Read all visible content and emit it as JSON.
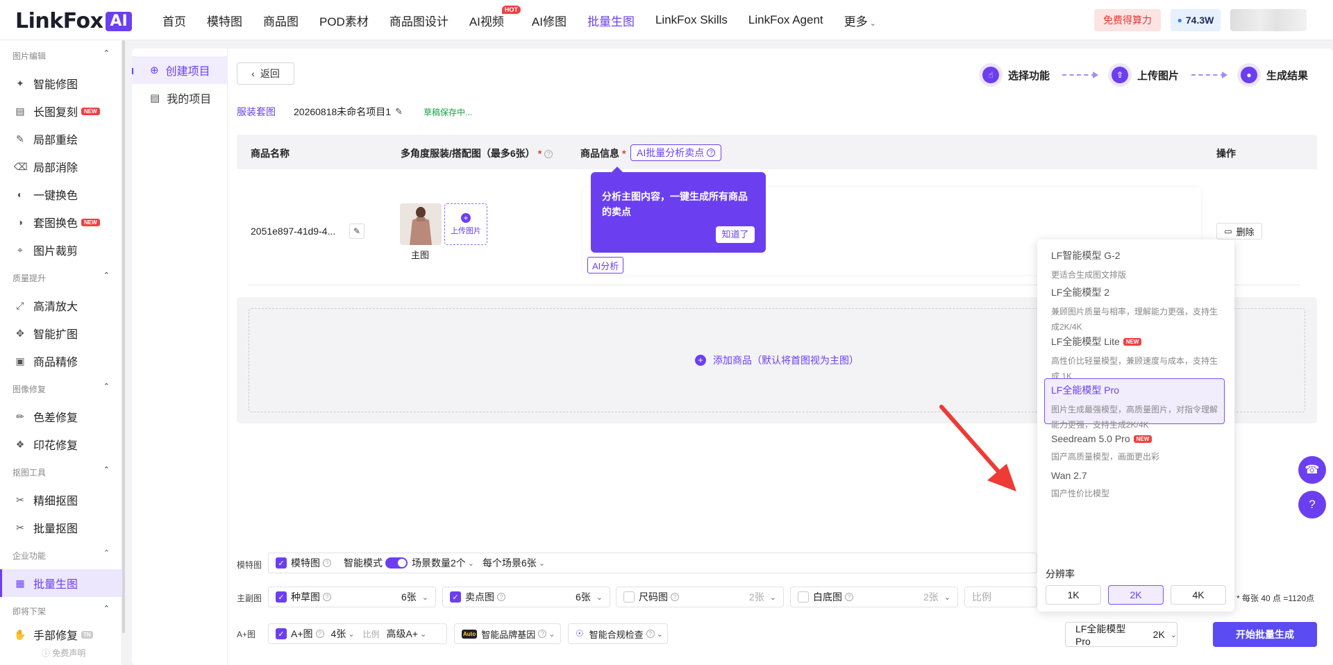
{
  "header": {
    "logo_text": "LinkFox",
    "logo_badge": "AI",
    "nav": [
      {
        "label": "首页"
      },
      {
        "label": "模特图"
      },
      {
        "label": "商品图"
      },
      {
        "label": "POD素材"
      },
      {
        "label": "商品图设计"
      },
      {
        "label": "AI视频",
        "badge": "HOT"
      },
      {
        "label": "AI修图"
      },
      {
        "label": "批量生图",
        "active": true
      },
      {
        "label": "LinkFox Skills"
      },
      {
        "label": "LinkFox Agent"
      },
      {
        "label": "更多"
      }
    ],
    "free_button": "免费得算力",
    "balance": "74.3W",
    "accent_color": "#6b3ff0"
  },
  "sidebar": {
    "groups": [
      {
        "title": "图片编辑",
        "items": [
          {
            "label": "智能修图",
            "icon": "magic-wand-icon"
          },
          {
            "label": "长图复刻",
            "icon": "copy-icon",
            "badge": "NEW"
          },
          {
            "label": "局部重绘",
            "icon": "brush-icon"
          },
          {
            "label": "局部消除",
            "icon": "eraser-icon"
          },
          {
            "label": "一键换色",
            "icon": "palette-icon"
          },
          {
            "label": "套图换色",
            "icon": "palette-icon",
            "badge": "NEW"
          },
          {
            "label": "图片裁剪",
            "icon": "crop-icon"
          }
        ]
      },
      {
        "title": "质量提升",
        "items": [
          {
            "label": "高清放大",
            "icon": "enlarge-icon"
          },
          {
            "label": "智能扩图",
            "icon": "expand-icon"
          },
          {
            "label": "商品精修",
            "icon": "retouch-icon"
          }
        ]
      },
      {
        "title": "图像修复",
        "items": [
          {
            "label": "色差修复",
            "icon": "dropper-icon"
          },
          {
            "label": "印花修复",
            "icon": "pattern-icon"
          }
        ]
      },
      {
        "title": "抠图工具",
        "items": [
          {
            "label": "精细抠图",
            "icon": "cutout-icon"
          },
          {
            "label": "批量抠图",
            "icon": "cutout-icon"
          }
        ]
      },
      {
        "title": "企业功能",
        "items": [
          {
            "label": "批量生图",
            "icon": "image-icon",
            "active": true
          }
        ]
      },
      {
        "title": "即将下架",
        "items": [
          {
            "label": "手部修复",
            "icon": "hand-icon",
            "badge": "TN"
          }
        ]
      }
    ],
    "footer": "免费声明"
  },
  "subnav": [
    {
      "label": "创建项目",
      "icon": "plus-circle-icon",
      "active": true
    },
    {
      "label": "我的项目",
      "icon": "folder-icon"
    }
  ],
  "toolbar": {
    "back_label": "返回"
  },
  "steps": [
    {
      "label": "选择功能",
      "icon": "pointer-icon"
    },
    {
      "label": "上传图片",
      "icon": "upload-icon"
    },
    {
      "label": "生成结果",
      "icon": "bulb-icon"
    }
  ],
  "project": {
    "type": "服装套图",
    "name": "20260818未命名项目1",
    "status": "草稿保存中..."
  },
  "table": {
    "col_name": "商品名称",
    "col_images": "多角度服装/搭配图（最多6张）",
    "col_info": "商品信息",
    "col_actions": "操作",
    "ai_analyze_button": "AI批量分析卖点",
    "row": {
      "id": "2051e897-41d9-4...",
      "image_label": "主图",
      "upload_label": "上传图片",
      "ai_button": "AI分析",
      "delete_label": "删除"
    }
  },
  "tooltip": {
    "text": "分析主图内容，一键生成所有商品的卖点",
    "button": "知道了"
  },
  "add_product": "添加商品（默认将首图视为主图）",
  "model_dropdown": {
    "options": [
      {
        "name": "LF智能模型 G-2",
        "desc": "更适合生成图文排版"
      },
      {
        "name": "LF全能模型 2",
        "desc": "兼顾图片质量与相率，理解能力更强，支持生成2K/4K"
      },
      {
        "name": "LF全能模型 Lite",
        "badge": "NEW",
        "desc": "高性价比轻量模型，兼顾速度与成本，支持生成 1K"
      },
      {
        "name": "LF全能模型 Pro",
        "selected": true,
        "desc": "图片生成最强模型，高质量图片，对指令理解能力更强，支持生成2K/4K"
      },
      {
        "name": "Seedream 5.0 Pro",
        "badge": "NEW",
        "desc": "国产高质量模型，画面更出彩"
      },
      {
        "name": "Wan 2.7",
        "desc": "国产性价比模型"
      }
    ],
    "resolution_label": "分辨率",
    "resolutions": [
      "1K",
      "2K",
      "4K"
    ],
    "selected_resolution": "2K"
  },
  "config": {
    "model_row": {
      "label": "模特图",
      "check_label": "模特图",
      "smart_mode": "智能模式",
      "scene_count": "场景数量2个",
      "per_scene": "每个场景6张"
    },
    "main_row": {
      "label": "主副图",
      "grass": "种草图",
      "grass_count": "6张",
      "selling": "卖点图",
      "selling_count": "6张",
      "size": "尺码图",
      "size_count": "2张",
      "white": "白底图",
      "white_count": "2张",
      "ratio": "比例"
    },
    "aplus_row": {
      "label": "A+图",
      "check_label": "A+图",
      "count": "4张",
      "ratio_label": "比例",
      "ratio_value": "高级A+",
      "brand_gene": "智能品牌基因",
      "auto_badge": "Auto",
      "compliance": "智能合规检查"
    },
    "cost_text": "* 每张 40 点 =1120点"
  },
  "bottom": {
    "model_selected": "LF全能模型 Pro",
    "resolution_selected": "2K",
    "start_button": "开始批量生成"
  }
}
